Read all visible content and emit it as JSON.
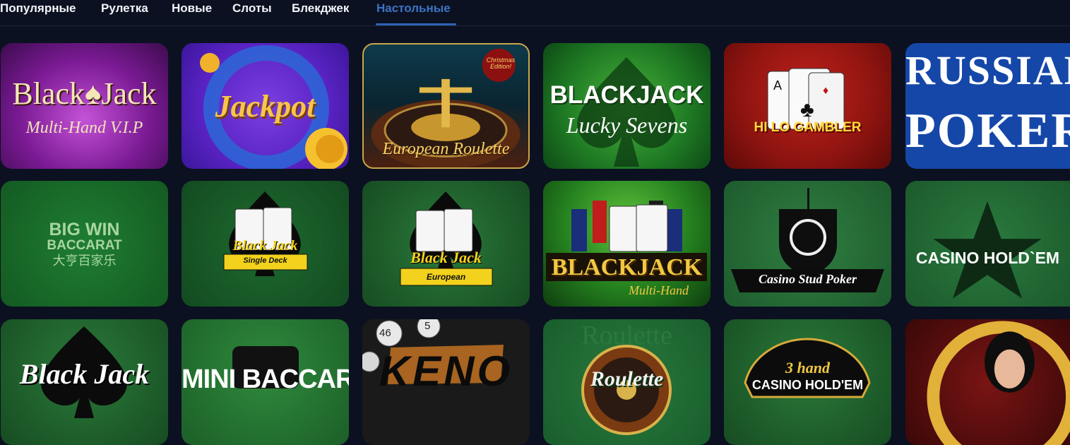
{
  "tabs": [
    {
      "label": "Популярные",
      "active": false
    },
    {
      "label": "Рулетка",
      "active": false
    },
    {
      "label": "Новые",
      "active": false
    },
    {
      "label": "Слоты",
      "active": false
    },
    {
      "label": "Блекджек",
      "active": false
    },
    {
      "label": "Настольные",
      "active": true
    }
  ],
  "colors": {
    "background": "#0b1120",
    "active_tab": "#3d73c4",
    "felt_green": "#1f6f35"
  },
  "games": {
    "r1": [
      {
        "line1": "Black",
        "line2": "Jack",
        "sub": "Multi-Hand V.I.P"
      },
      {
        "title": "Jackpot"
      },
      {
        "badge": "Christmas Edition!",
        "title": "European Roulette"
      },
      {
        "line1": "BLACKJACK",
        "line2": "Lucky Sevens"
      },
      {
        "title": "HI LO GAMBLER"
      },
      {
        "line1": "RUSSIAN",
        "line2": "POKER"
      }
    ],
    "r2": [
      {
        "line1": "BIG WIN",
        "line2": "BACCARAT",
        "line3": "大亨百家乐"
      },
      {
        "line1": "Black Jack",
        "line2": "Single Deck"
      },
      {
        "line1": "Black Jack",
        "line2": "European"
      },
      {
        "line1": "BLACKJACK",
        "line2": "Multi-Hand"
      },
      {
        "title": "Casino Stud Poker"
      },
      {
        "title": "CASINO HOLD`EM"
      }
    ],
    "r3": [
      {
        "title": "Black Jack"
      },
      {
        "title": "MINI BACCARAT"
      },
      {
        "title": "KENO",
        "ball1": "46",
        "ball2": "5"
      },
      {
        "line1": "Roulette",
        "line2": "Roulette"
      },
      {
        "line1": "3 hand",
        "line2": "CASINO HOLD'EM"
      },
      {
        "title": ""
      }
    ]
  }
}
